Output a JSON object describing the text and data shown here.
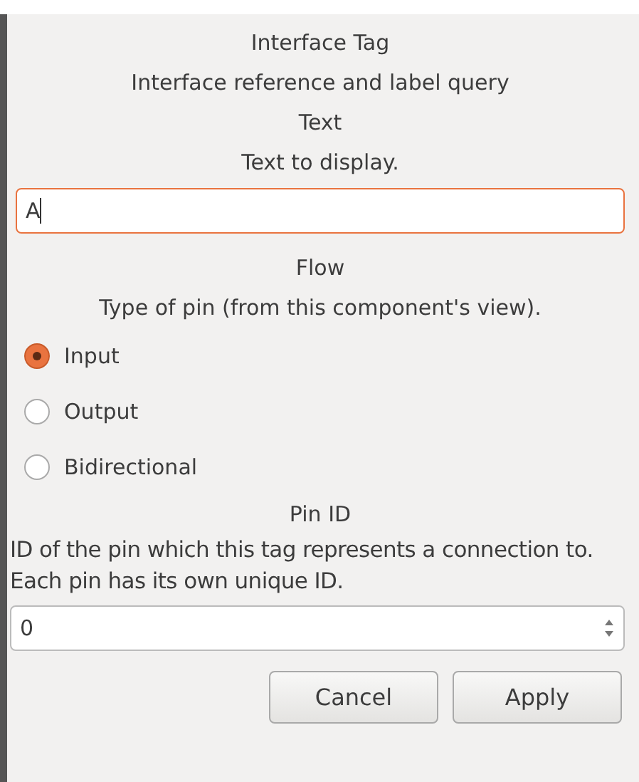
{
  "dialog": {
    "title": "Interface Tag",
    "subtitle": "Interface reference and label query"
  },
  "text_field": {
    "label": "Text",
    "description": "Text to display.",
    "value": "A",
    "focused": true
  },
  "flow": {
    "label": "Flow",
    "description": "Type of pin (from this component's view).",
    "options": [
      {
        "label": "Input",
        "selected": true
      },
      {
        "label": "Output",
        "selected": false
      },
      {
        "label": "Bidirectional",
        "selected": false
      }
    ]
  },
  "pin_id": {
    "label": "Pin ID",
    "description": "ID of the pin which this tag represents a connection to. Each pin has its own unique ID.",
    "value": "0"
  },
  "buttons": [
    "Cancel",
    "Apply"
  ]
}
